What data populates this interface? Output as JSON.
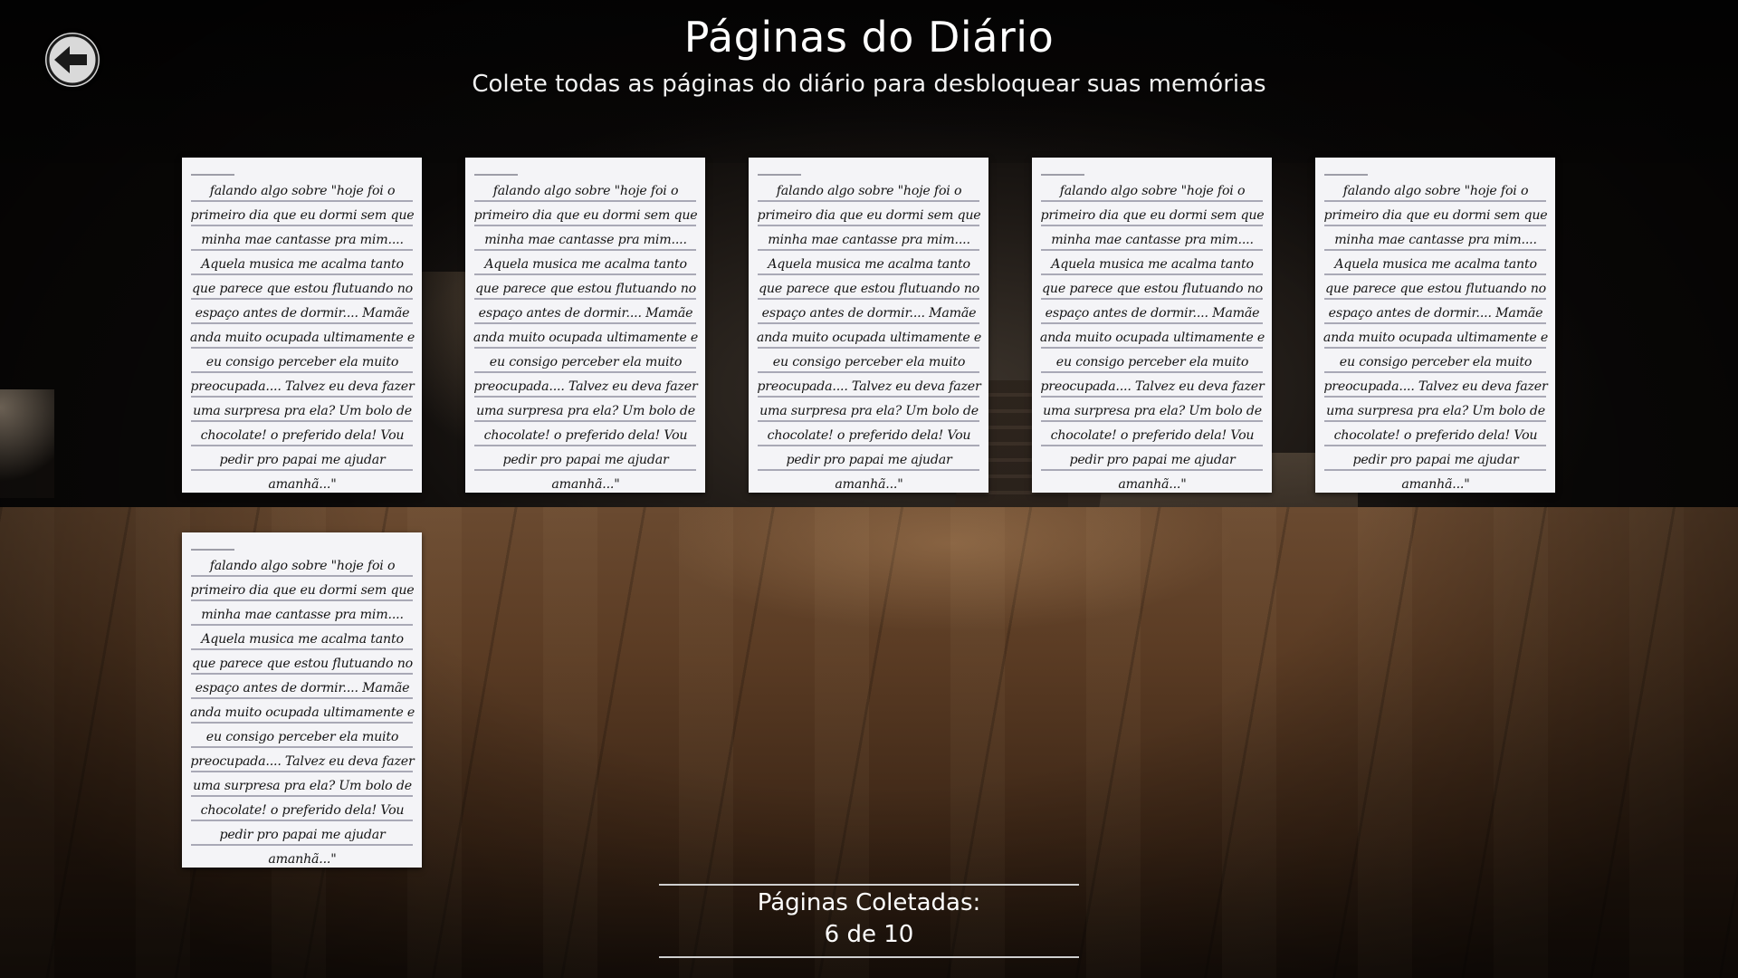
{
  "header": {
    "title": "Páginas do Diário",
    "subtitle": "Colete todas as páginas do diário para desbloquear suas memórias"
  },
  "back_button": {
    "icon": "arrow-left-icon"
  },
  "pages": [
    {
      "text": "falando algo sobre \"hoje foi o primeiro dia que eu dormi sem que minha mae cantasse pra mim.... Aquela musica me acalma tanto que parece que estou flutuando no espaço antes de dormir.... Mamãe anda muito ocupada ultimamente e eu consigo perceber ela muito preocupada.... Talvez eu deva fazer uma surpresa pra ela? Um bolo de chocolate! o preferido dela! Vou pedir pro papai me ajudar amanhã...\""
    },
    {
      "text": "falando algo sobre \"hoje foi o primeiro dia que eu dormi sem que minha mae cantasse pra mim.... Aquela musica me acalma tanto que parece que estou flutuando no espaço antes de dormir.... Mamãe anda muito ocupada ultimamente e eu consigo perceber ela muito preocupada.... Talvez eu deva fazer uma surpresa pra ela? Um bolo de chocolate! o preferido dela! Vou pedir pro papai me ajudar amanhã...\""
    },
    {
      "text": "falando algo sobre \"hoje foi o primeiro dia que eu dormi sem que minha mae cantasse pra mim.... Aquela musica me acalma tanto que parece que estou flutuando no espaço antes de dormir.... Mamãe anda muito ocupada ultimamente e eu consigo perceber ela muito preocupada.... Talvez eu deva fazer uma surpresa pra ela? Um bolo de chocolate! o preferido dela! Vou pedir pro papai me ajudar amanhã...\""
    },
    {
      "text": "falando algo sobre \"hoje foi o primeiro dia que eu dormi sem que minha mae cantasse pra mim.... Aquela musica me acalma tanto que parece que estou flutuando no espaço antes de dormir.... Mamãe anda muito ocupada ultimamente e eu consigo perceber ela muito preocupada.... Talvez eu deva fazer uma surpresa pra ela? Um bolo de chocolate! o preferido dela! Vou pedir pro papai me ajudar amanhã...\""
    },
    {
      "text": "falando algo sobre \"hoje foi o primeiro dia que eu dormi sem que minha mae cantasse pra mim.... Aquela musica me acalma tanto que parece que estou flutuando no espaço antes de dormir.... Mamãe anda muito ocupada ultimamente e eu consigo perceber ela muito preocupada.... Talvez eu deva fazer uma surpresa pra ela? Um bolo de chocolate! o preferido dela! Vou pedir pro papai me ajudar amanhã...\""
    },
    {
      "text": "falando algo sobre \"hoje foi o primeiro dia que eu dormi sem que minha mae cantasse pra mim.... Aquela musica me acalma tanto que parece que estou flutuando no espaço antes de dormir.... Mamãe anda muito ocupada ultimamente e eu consigo perceber ela muito preocupada.... Talvez eu deva fazer uma surpresa pra ela? Um bolo de chocolate! o preferido dela! Vou pedir pro papai me ajudar amanhã...\""
    }
  ],
  "counter": {
    "label": "Páginas Coletadas:",
    "value": "6 de 10",
    "collected": 6,
    "total": 10
  },
  "colors": {
    "text": "#ffffff",
    "page_background": "#f4f4f7",
    "page_lines": "#a9a9b6",
    "button_background": "#d9d9d9"
  }
}
